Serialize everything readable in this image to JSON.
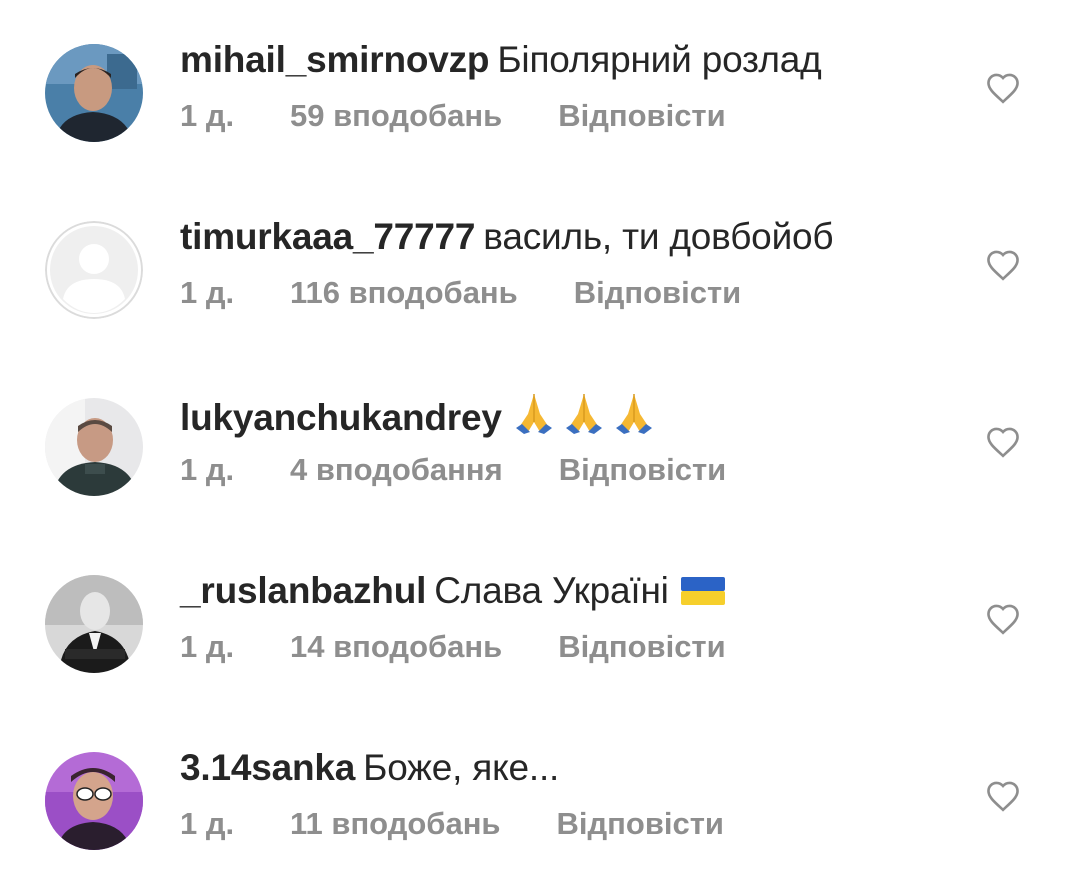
{
  "comments": [
    {
      "username": "mihail_smirnovzp",
      "text": "Біполярний розлад",
      "emoji": "",
      "time": "1 д.",
      "likes": "59 вподобань",
      "reply_label": "Відповісти",
      "avatar_icon": "user-photo"
    },
    {
      "username": "timurkaaa_77777",
      "text": "василь, ти довбойоб",
      "emoji": "",
      "time": "1 д.",
      "likes": "116 вподобань",
      "reply_label": "Відповісти",
      "avatar_icon": "default-avatar-icon"
    },
    {
      "username": "lukyanchukandrey",
      "text": "",
      "emoji": "praying-hands x3",
      "time": "1 д.",
      "likes": "4 вподобання",
      "reply_label": "Відповісти",
      "avatar_icon": "user-photo"
    },
    {
      "username": "_ruslanbazhul",
      "text": "Слава Україні",
      "emoji": "ukraine-flag",
      "time": "1 д.",
      "likes": "14 вподобань",
      "reply_label": "Відповісти",
      "avatar_icon": "user-photo"
    },
    {
      "username": "3.14sanka",
      "text": "Боже, яке...",
      "emoji": "",
      "time": "1 д.",
      "likes": "11 вподобань",
      "reply_label": "Відповісти",
      "avatar_icon": "user-photo"
    }
  ],
  "colors": {
    "text": "#262626",
    "meta": "#8e8e8e",
    "heart_outline": "#8e8e8e"
  }
}
